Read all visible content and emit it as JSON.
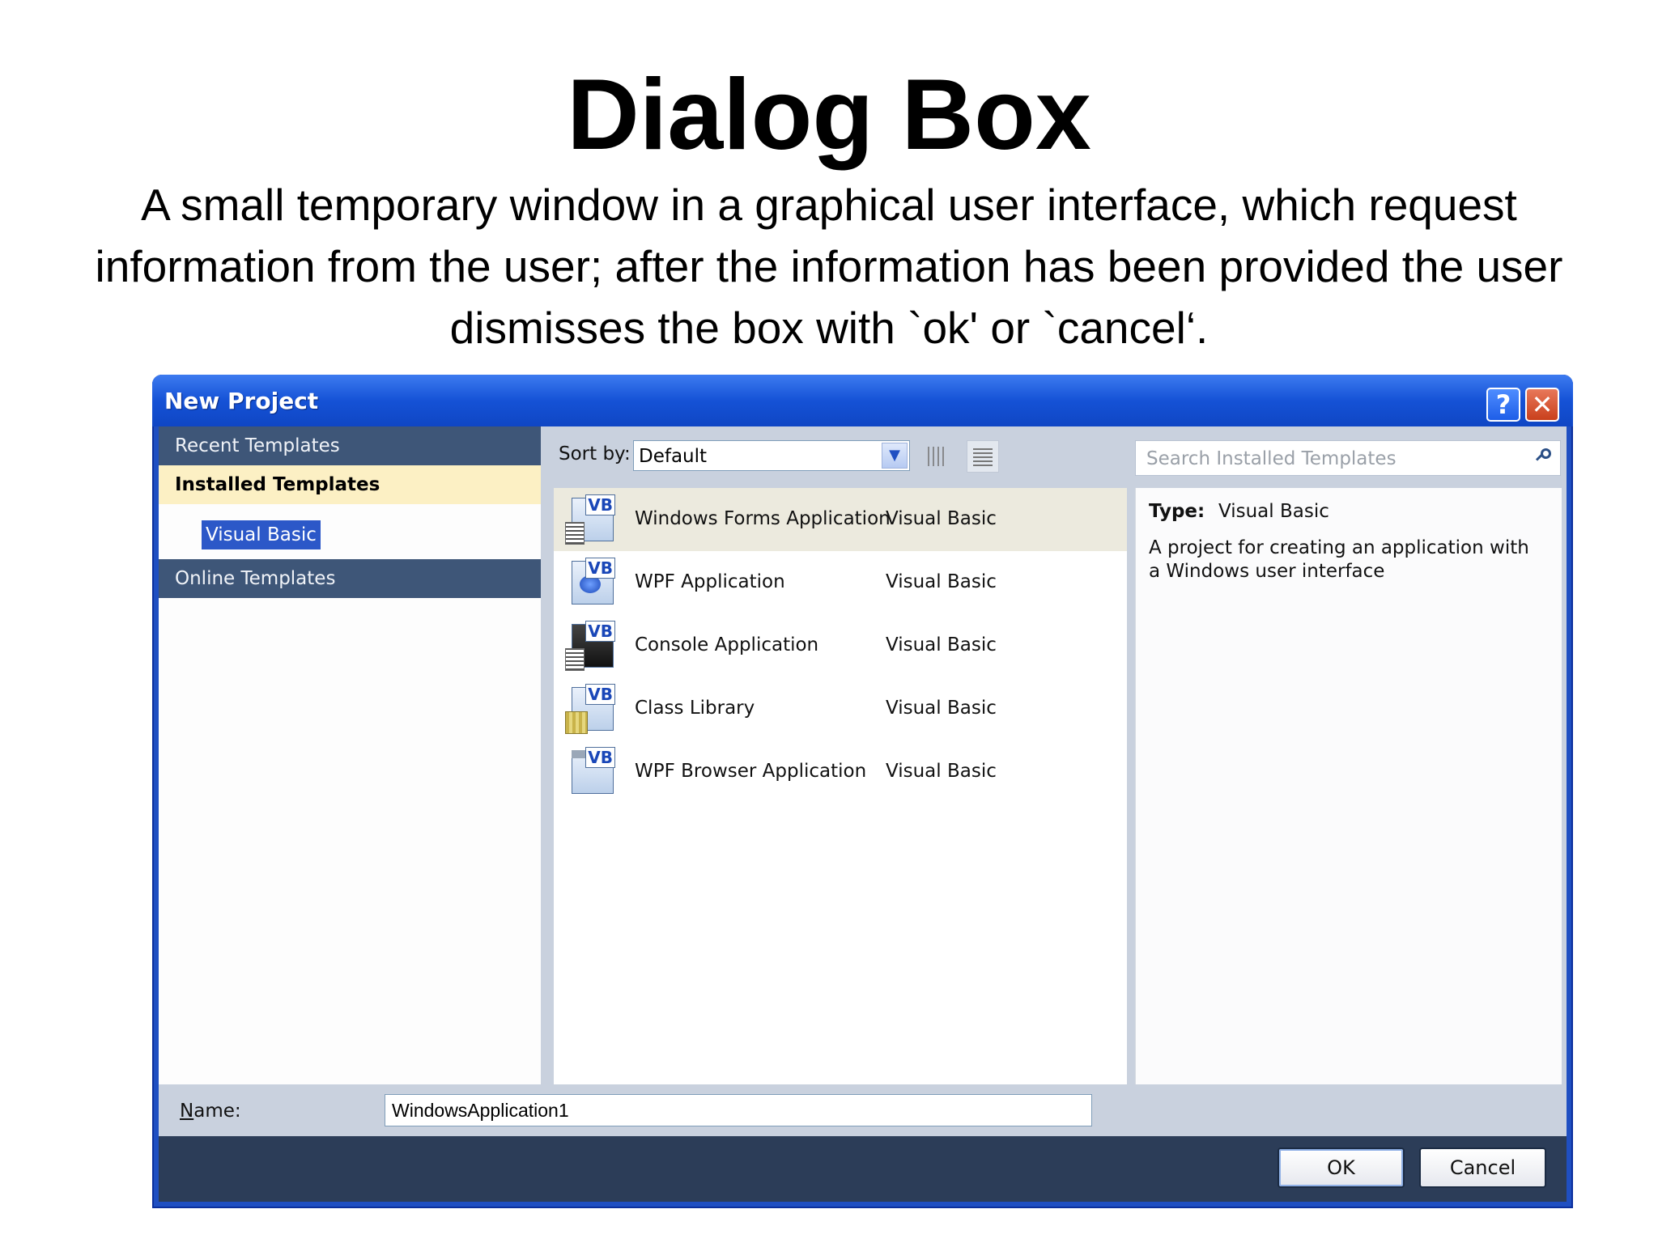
{
  "slide": {
    "title": "Dialog Box",
    "body": "A small temporary window in a graphical user interface, which request information from the user; after the information has been provided the user dismisses the box with `ok' or `cancel‘."
  },
  "dialog": {
    "title": "New Project",
    "help_glyph": "?",
    "close_glyph": "✕",
    "nav": {
      "recent": "Recent Templates",
      "installed": "Installed Templates",
      "visual_basic": "Visual Basic",
      "online": "Online Templates"
    },
    "sort": {
      "label": "Sort by:",
      "value": "Default"
    },
    "search": {
      "placeholder": "Search Installed Templates"
    },
    "templates": [
      {
        "name": "Windows Forms Application",
        "lang": "Visual Basic"
      },
      {
        "name": "WPF Application",
        "lang": "Visual Basic"
      },
      {
        "name": "Console Application",
        "lang": "Visual Basic"
      },
      {
        "name": "Class Library",
        "lang": "Visual Basic"
      },
      {
        "name": "WPF Browser Application",
        "lang": "Visual Basic"
      }
    ],
    "info": {
      "type_label": "Type:",
      "type_value": "Visual Basic",
      "description": "A project for creating an application with a Windows user interface"
    },
    "name_field": {
      "label_first": "N",
      "label_rest": "ame:",
      "value": "WindowsApplication1"
    },
    "buttons": {
      "ok": "OK",
      "cancel": "Cancel"
    }
  },
  "colors": {
    "titlebar": "#1f4fc2",
    "nav_dark": "#3e5678",
    "nav_selected": "#fcf0c4",
    "selection": "#2c58c8"
  }
}
